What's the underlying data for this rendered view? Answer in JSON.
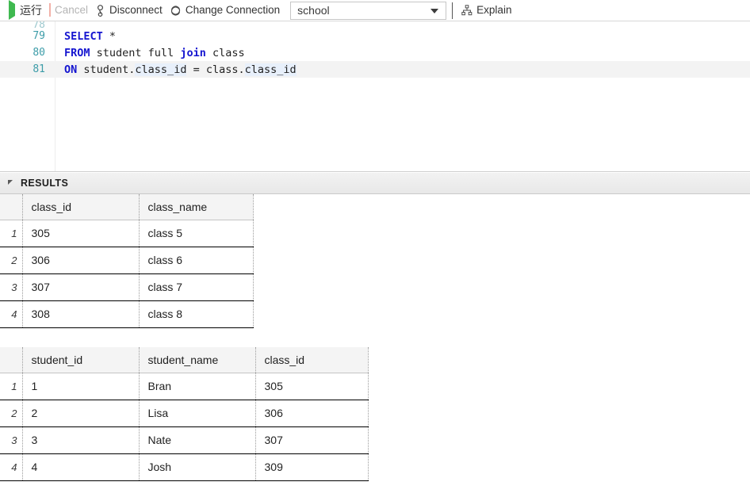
{
  "toolbar": {
    "run": {
      "label": "运行",
      "icon": "play-icon"
    },
    "cancel": {
      "label": "Cancel",
      "icon": "stop-square-icon",
      "enabled": false
    },
    "disconnect": {
      "label": "Disconnect",
      "icon": "plug-disconnect-icon"
    },
    "change_connection": {
      "label": "Change Connection",
      "icon": "swap-circle-icon"
    },
    "connection_select": {
      "value": "school",
      "icon": "chevron-down-icon"
    },
    "explain": {
      "label": "Explain",
      "icon": "tree-hierarchy-icon"
    }
  },
  "editor": {
    "lines": [
      {
        "number": "78",
        "partial": true,
        "tokens": []
      },
      {
        "number": "79",
        "current": false,
        "tokens": [
          {
            "text": "SELECT",
            "type": "keyword"
          },
          {
            "text": " *",
            "type": "plain"
          }
        ]
      },
      {
        "number": "80",
        "current": false,
        "tokens": [
          {
            "text": "FROM",
            "type": "keyword"
          },
          {
            "text": " student full ",
            "type": "plain"
          },
          {
            "text": "join",
            "type": "keyword"
          },
          {
            "text": " class",
            "type": "plain"
          }
        ]
      },
      {
        "number": "81",
        "current": true,
        "tokens": [
          {
            "text": "ON",
            "type": "keyword"
          },
          {
            "text": " student.",
            "type": "plain"
          },
          {
            "text": "class_id",
            "type": "highlight"
          },
          {
            "text": " = class.",
            "type": "plain"
          },
          {
            "text": "class_id",
            "type": "highlight"
          }
        ]
      }
    ]
  },
  "results": {
    "title": "RESULTS",
    "collapse_icon": "triangle-collapse-icon",
    "tables": [
      {
        "columns": [
          "class_id",
          "class_name"
        ],
        "rows": [
          {
            "n": "1",
            "cells": [
              "305",
              "class 5"
            ]
          },
          {
            "n": "2",
            "cells": [
              "306",
              "class 6"
            ]
          },
          {
            "n": "3",
            "cells": [
              "307",
              "class 7"
            ]
          },
          {
            "n": "4",
            "cells": [
              "308",
              "class 8"
            ]
          }
        ]
      },
      {
        "columns": [
          "student_id",
          "student_name",
          "class_id"
        ],
        "rows": [
          {
            "n": "1",
            "cells": [
              "1",
              "Bran",
              "305"
            ]
          },
          {
            "n": "2",
            "cells": [
              "2",
              "Lisa",
              "306"
            ]
          },
          {
            "n": "3",
            "cells": [
              "3",
              "Nate",
              "307"
            ]
          },
          {
            "n": "4",
            "cells": [
              "4",
              "Josh",
              "309"
            ]
          }
        ]
      }
    ]
  },
  "colors": {
    "run_green": "#3fb950",
    "cancel_salmon": "#f2b0a8",
    "keyword_blue": "#1515d0",
    "linenumber_teal": "#3c9ca8",
    "token_highlight": "#e8f0fb"
  }
}
